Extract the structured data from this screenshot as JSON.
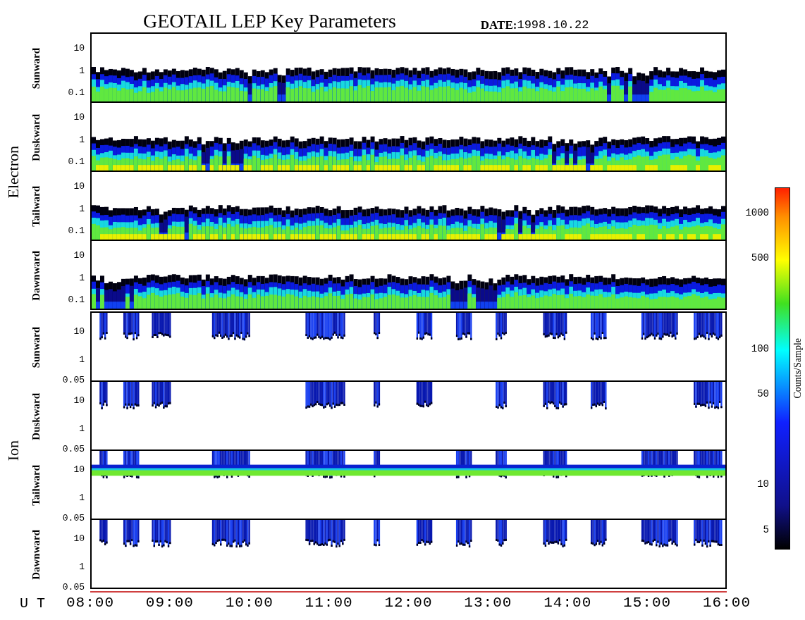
{
  "title": "GEOTAIL LEP Key Parameters",
  "date": {
    "label": "DATE:",
    "value": "1998.10.22"
  },
  "groups": [
    {
      "label": "Electron",
      "kind": "electron",
      "panels": [
        {
          "label": "Sunward",
          "yticks": [
            "10",
            "1",
            "0.1"
          ]
        },
        {
          "label": "Duskward",
          "yticks": [
            "10",
            "1",
            "0.1"
          ]
        },
        {
          "label": "Tailward",
          "yticks": [
            "10",
            "1",
            "0.1"
          ]
        },
        {
          "label": "Dawnward",
          "yticks": [
            "10",
            "1",
            "0.1"
          ]
        }
      ]
    },
    {
      "label": "Ion",
      "kind": "ion",
      "panels": [
        {
          "label": "Sunward",
          "yticks": [
            "10",
            "1",
            "0.05"
          ]
        },
        {
          "label": "Duskward",
          "yticks": [
            "10",
            "1",
            "0.05"
          ]
        },
        {
          "label": "Tailward",
          "yticks": [
            "10",
            "1",
            "0.05"
          ]
        },
        {
          "label": "Dawnward",
          "yticks": [
            "10",
            "1",
            "0.05"
          ]
        }
      ]
    }
  ],
  "time_axis": {
    "label": "U T",
    "ticks": [
      "08:00",
      "09:00",
      "10:00",
      "11:00",
      "12:00",
      "13:00",
      "14:00",
      "15:00",
      "16:00"
    ]
  },
  "colorbar": {
    "label": "Counts/Sample",
    "ticks": [
      "1000",
      "500",
      "100",
      "50",
      "10",
      "5"
    ]
  }
}
